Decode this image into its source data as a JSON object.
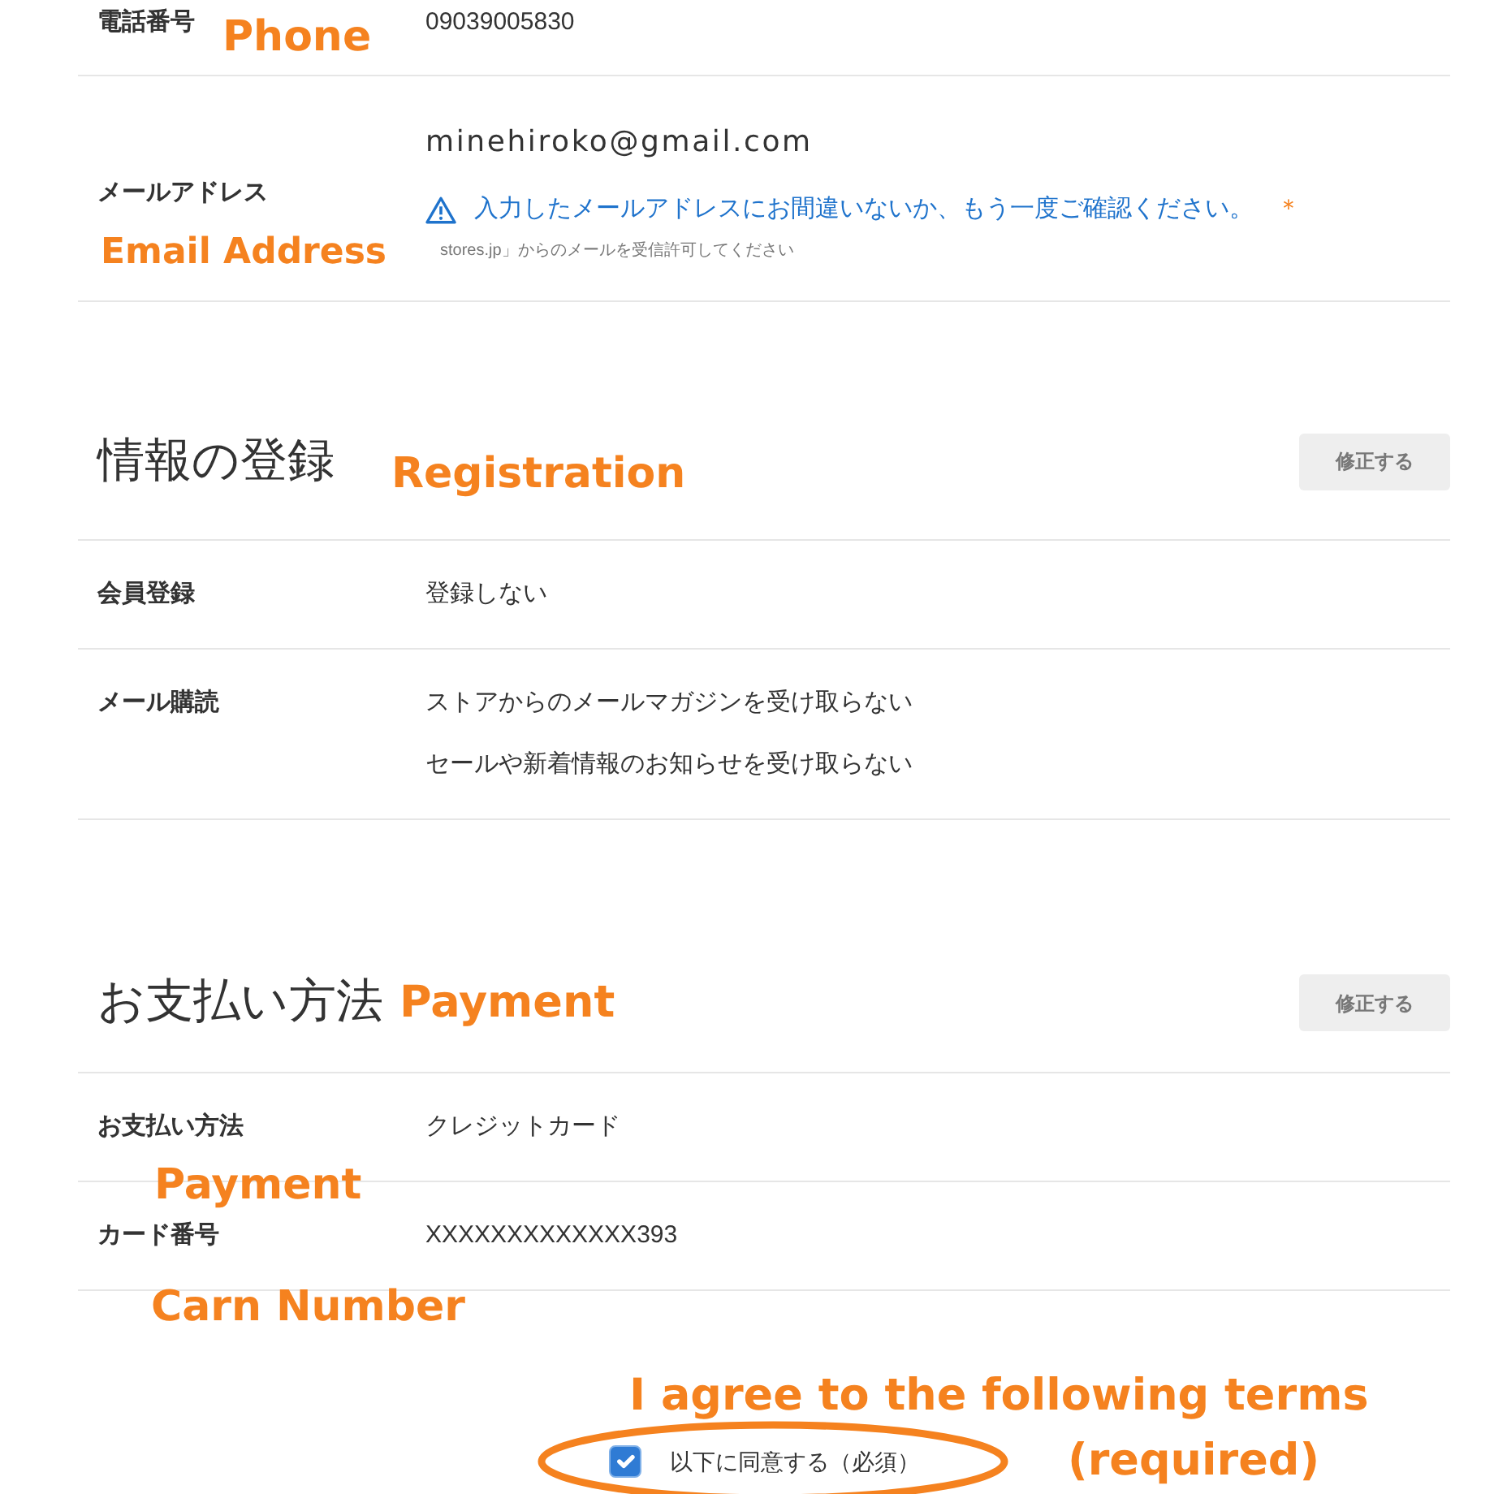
{
  "contact_rows": [
    {
      "label": "電話番号",
      "annotation": "Phone",
      "values": [
        {
          "kind": "text",
          "text": "09039005830"
        }
      ]
    },
    {
      "label": "メールアドレス",
      "annotation": "Email Address",
      "values": [
        {
          "kind": "email",
          "text": "minehiroko@gmail.com"
        },
        {
          "kind": "warning",
          "text": "入力したメールアドレスにお間違いないか、もう一度ご確認ください。",
          "asterisk": "＊"
        },
        {
          "kind": "note",
          "text": "stores.jp」からのメールを受信許可してください"
        }
      ]
    }
  ],
  "sections": [
    {
      "title": "情報の登録",
      "annotation": "Registration",
      "edit_button": "修正する",
      "rows": [
        {
          "label": "会員登録",
          "values": [
            {
              "kind": "text",
              "text": "登録しない"
            }
          ]
        },
        {
          "label": "メール購読",
          "values": [
            {
              "kind": "text",
              "text": "ストアからのメールマガジンを受け取らない"
            },
            {
              "kind": "text",
              "text": "セールや新着情報のお知らせを受け取らない"
            }
          ]
        }
      ]
    },
    {
      "title": "お支払い方法",
      "annotation": "Payment",
      "edit_button": "修正する",
      "rows": [
        {
          "label": "お支払い方法",
          "annotation": "Payment",
          "values": [
            {
              "kind": "text",
              "text": "クレジットカード"
            }
          ]
        },
        {
          "label": "カード番号",
          "annotation": "Carn Number",
          "values": [
            {
              "kind": "text",
              "text": "XXXXXXXXXXXXX393"
            }
          ]
        }
      ]
    }
  ],
  "agreement": {
    "label": "以下に同意する（必須）",
    "checked": true,
    "circled": true,
    "annotations": [
      "I agree to the following terms",
      "(required)"
    ]
  }
}
